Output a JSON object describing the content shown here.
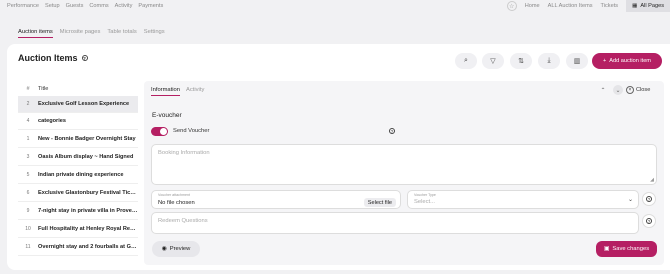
{
  "topnav": {
    "left_items": [
      "Performance",
      "Setup",
      "Guests",
      "Comms",
      "Activity",
      "Payments"
    ],
    "right_items": [
      "Home",
      "ALL Auction Items",
      "Tickets"
    ],
    "all_pages": "All Pages"
  },
  "subnav": {
    "tabs": [
      "Auction items",
      "Microsite pages",
      "Table totals",
      "Settings"
    ]
  },
  "page": {
    "title": "Auction Items",
    "add_button": "Add auction item"
  },
  "table": {
    "headers": {
      "num": "#",
      "title": "Title"
    },
    "rows": [
      {
        "num": "2",
        "title": "Exclusive Golf Lesson Experience"
      },
      {
        "num": "4",
        "title": "categories"
      },
      {
        "num": "1",
        "title": "New - Bonnie Badger Overnight Stay"
      },
      {
        "num": "3",
        "title": "Oasis Album display ~ Hand Signed"
      },
      {
        "num": "5",
        "title": "Indian private dining experience"
      },
      {
        "num": "6",
        "title": "Exclusive Glastonbury Festival Tickets"
      },
      {
        "num": "9",
        "title": "7-night stay in private villa in Provence"
      },
      {
        "num": "10",
        "title": "Full Hospitality at Henley Royal Regatta"
      },
      {
        "num": "11",
        "title": "Overnight stay and 2 fourballs at Gleneagles"
      }
    ]
  },
  "panel": {
    "tabs": [
      "Information",
      "Activity"
    ],
    "close_label": "Close",
    "section_title": "E-voucher",
    "send_voucher_label": "Send Voucher",
    "send_voucher_on": true,
    "booking_placeholder": "Booking Information",
    "voucher_attachment_label": "Voucher attachment",
    "file_value": "No file chosen",
    "file_button": "Select file",
    "voucher_type_label": "Voucher Type",
    "voucher_type_placeholder": "Select...",
    "redeem_placeholder": "Redeem Questions",
    "preview_label": "Preview",
    "save_label": "Save changes"
  },
  "colors": {
    "accent": "#b51f63",
    "background": "#f1f1f3"
  }
}
